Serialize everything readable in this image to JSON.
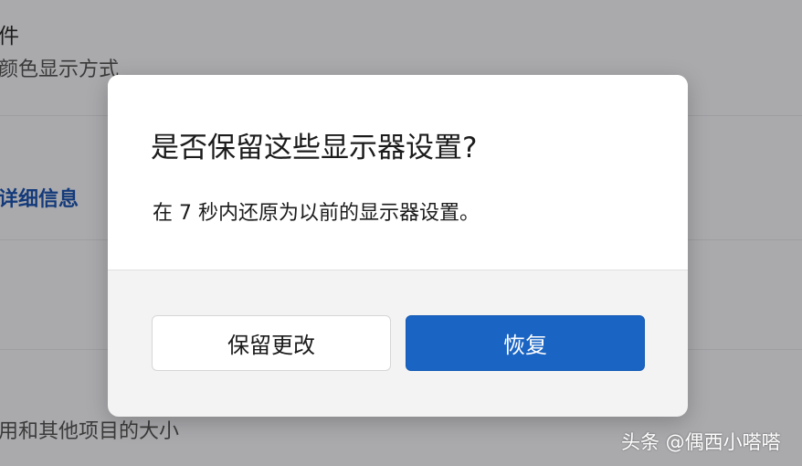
{
  "background": {
    "section_title": "件",
    "section_subtitle": "颜色显示方式",
    "details_link": "详细信息",
    "bottom_text": "用和其他项目的大小"
  },
  "dialog": {
    "title": "是否保留这些显示器设置?",
    "message": "在  7 秒内还原为以前的显示器设置。",
    "keep_button_label": "保留更改",
    "revert_button_label": "恢复"
  },
  "watermark": "头条 @偶西小嗒嗒",
  "colors": {
    "primary_button": "#1a64c3",
    "overlay": "#aaaaad",
    "dialog_bg": "#ffffff"
  }
}
